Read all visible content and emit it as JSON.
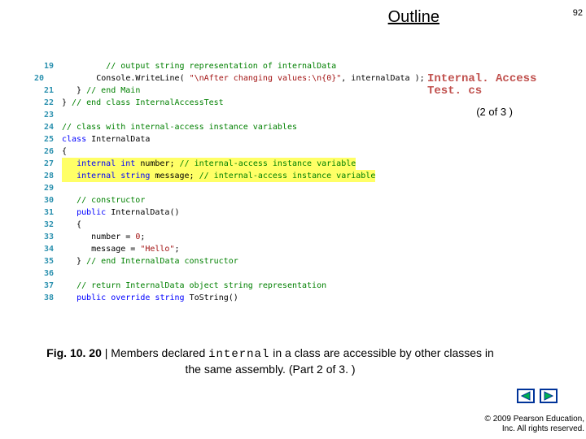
{
  "header": {
    "outline_label": "Outline",
    "page_number": "92"
  },
  "source_file": {
    "line1": "Internal. Access",
    "line2": "Test. cs"
  },
  "part_indicator": "(2 of 3 )",
  "code_lines": [
    {
      "n": "19",
      "hl": false,
      "tokens": [
        {
          "cls": "tok-txt",
          "t": "         "
        },
        {
          "cls": "tok-com",
          "t": "// output string representation of internalData"
        }
      ]
    },
    {
      "n": "20",
      "hl": false,
      "tokens": [
        {
          "cls": "tok-txt",
          "t": "         Console.WriteLine( "
        },
        {
          "cls": "tok-str",
          "t": "\"\\nAfter changing values:\\n{0}\""
        },
        {
          "cls": "tok-txt",
          "t": ", internalData );"
        }
      ]
    },
    {
      "n": "21",
      "hl": false,
      "tokens": [
        {
          "cls": "tok-txt",
          "t": "   } "
        },
        {
          "cls": "tok-com",
          "t": "// end Main"
        }
      ]
    },
    {
      "n": "22",
      "hl": false,
      "tokens": [
        {
          "cls": "tok-txt",
          "t": "} "
        },
        {
          "cls": "tok-com",
          "t": "// end class InternalAccessTest"
        }
      ]
    },
    {
      "n": "23",
      "hl": false,
      "tokens": [
        {
          "cls": "tok-txt",
          "t": ""
        }
      ]
    },
    {
      "n": "24",
      "hl": false,
      "tokens": [
        {
          "cls": "tok-com",
          "t": "// class with internal-access instance variables"
        }
      ]
    },
    {
      "n": "25",
      "hl": false,
      "tokens": [
        {
          "cls": "tok-kw",
          "t": "class"
        },
        {
          "cls": "tok-txt",
          "t": " InternalData"
        }
      ]
    },
    {
      "n": "26",
      "hl": false,
      "tokens": [
        {
          "cls": "tok-txt",
          "t": "{"
        }
      ]
    },
    {
      "n": "27",
      "hl": true,
      "tokens": [
        {
          "cls": "tok-txt",
          "t": "   "
        },
        {
          "cls": "tok-kw",
          "t": "internal"
        },
        {
          "cls": "tok-txt",
          "t": " "
        },
        {
          "cls": "tok-kw",
          "t": "int"
        },
        {
          "cls": "tok-txt",
          "t": " number; "
        },
        {
          "cls": "tok-com",
          "t": "// internal-access instance variable"
        }
      ]
    },
    {
      "n": "28",
      "hl": true,
      "tokens": [
        {
          "cls": "tok-txt",
          "t": "   "
        },
        {
          "cls": "tok-kw",
          "t": "internal"
        },
        {
          "cls": "tok-txt",
          "t": " "
        },
        {
          "cls": "tok-kw",
          "t": "string"
        },
        {
          "cls": "tok-txt",
          "t": " message; "
        },
        {
          "cls": "tok-com",
          "t": "// internal-access instance variable"
        }
      ]
    },
    {
      "n": "29",
      "hl": false,
      "tokens": [
        {
          "cls": "tok-txt",
          "t": ""
        }
      ]
    },
    {
      "n": "30",
      "hl": false,
      "tokens": [
        {
          "cls": "tok-txt",
          "t": "   "
        },
        {
          "cls": "tok-com",
          "t": "// constructor"
        }
      ]
    },
    {
      "n": "31",
      "hl": false,
      "tokens": [
        {
          "cls": "tok-txt",
          "t": "   "
        },
        {
          "cls": "tok-kw",
          "t": "public"
        },
        {
          "cls": "tok-txt",
          "t": " InternalData()"
        }
      ]
    },
    {
      "n": "32",
      "hl": false,
      "tokens": [
        {
          "cls": "tok-txt",
          "t": "   {"
        }
      ]
    },
    {
      "n": "33",
      "hl": false,
      "tokens": [
        {
          "cls": "tok-txt",
          "t": "      number = "
        },
        {
          "cls": "tok-str",
          "t": "0"
        },
        {
          "cls": "tok-txt",
          "t": ";"
        }
      ]
    },
    {
      "n": "34",
      "hl": false,
      "tokens": [
        {
          "cls": "tok-txt",
          "t": "      message = "
        },
        {
          "cls": "tok-str",
          "t": "\"Hello\""
        },
        {
          "cls": "tok-txt",
          "t": ";"
        }
      ]
    },
    {
      "n": "35",
      "hl": false,
      "tokens": [
        {
          "cls": "tok-txt",
          "t": "   } "
        },
        {
          "cls": "tok-com",
          "t": "// end InternalData constructor"
        }
      ]
    },
    {
      "n": "36",
      "hl": false,
      "tokens": [
        {
          "cls": "tok-txt",
          "t": ""
        }
      ]
    },
    {
      "n": "37",
      "hl": false,
      "tokens": [
        {
          "cls": "tok-txt",
          "t": "   "
        },
        {
          "cls": "tok-com",
          "t": "// return InternalData object string representation"
        }
      ]
    },
    {
      "n": "38",
      "hl": false,
      "tokens": [
        {
          "cls": "tok-txt",
          "t": "   "
        },
        {
          "cls": "tok-kw",
          "t": "public"
        },
        {
          "cls": "tok-txt",
          "t": " "
        },
        {
          "cls": "tok-kw",
          "t": "override"
        },
        {
          "cls": "tok-txt",
          "t": " "
        },
        {
          "cls": "tok-kw",
          "t": "string"
        },
        {
          "cls": "tok-txt",
          "t": " ToString()"
        }
      ]
    }
  ],
  "caption": {
    "fig_label": "Fig. 10. 20",
    "sep": " | ",
    "pre": "Members declared ",
    "mono": "internal",
    "post": " in a class are accessible by other classes in the same assembly. (Part 2 of 3. )"
  },
  "nav": {
    "prev_name": "prev-slide-button",
    "next_name": "next-slide-button"
  },
  "copyright": {
    "line1": "© 2009 Pearson Education,",
    "line2": "Inc.  All rights reserved."
  },
  "colors": {
    "accent_red": "#c0504d",
    "nav_blue": "#003399",
    "nav_fill": "#00b050"
  }
}
